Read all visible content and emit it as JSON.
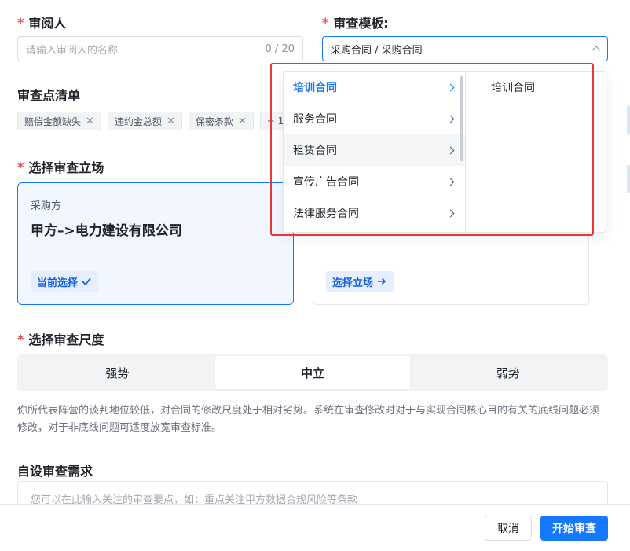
{
  "reviewer": {
    "label": "审阅人",
    "placeholder": "请输入审阅人的名称",
    "counter": "0 / 20"
  },
  "template": {
    "label": "审查模板:",
    "value": "采购合同 / 采购合同"
  },
  "checklist": {
    "label": "审查点清单",
    "tags": [
      "赔偿金额缺失",
      "违约金总额",
      "保密条款"
    ],
    "more": "+ 1"
  },
  "stance": {
    "label": "选择审查立场",
    "cards": [
      {
        "role": "采购方",
        "party": "甲方–>电力建设有限公司",
        "action": "当前选择",
        "action_icon": "check-icon"
      },
      {
        "role": "",
        "party": "",
        "action": "选择立场",
        "action_icon": "arrow-right-icon"
      }
    ]
  },
  "scale": {
    "label": "选择审查尺度",
    "options": [
      "强势",
      "中立",
      "弱势"
    ],
    "selected": "中立",
    "description": "你所代表阵营的谈判地位较低，对合同的修改尺度处于相对劣势。系统在审查修改时对于与实现合同核心目的有关的底线问题必须修改，对于非底线问题可适度放宽审查标准。"
  },
  "custom": {
    "label": "自设审查需求",
    "placeholder": "您可以在此输入关注的审查要点，如：重点关注甲方数据合规风险等条款"
  },
  "footer": {
    "cancel": "取消",
    "start": "开始审查"
  },
  "cascader": {
    "level1": [
      "培训合同",
      "服务合同",
      "租赁合同",
      "宣传广告合同",
      "法律服务合同"
    ],
    "selected": "培训合同",
    "hovered": "租赁合同",
    "level2": [
      "培训合同"
    ]
  },
  "colors": {
    "accent": "#1677ff",
    "highlight_box": "#e53935",
    "required": "#e5484d"
  }
}
